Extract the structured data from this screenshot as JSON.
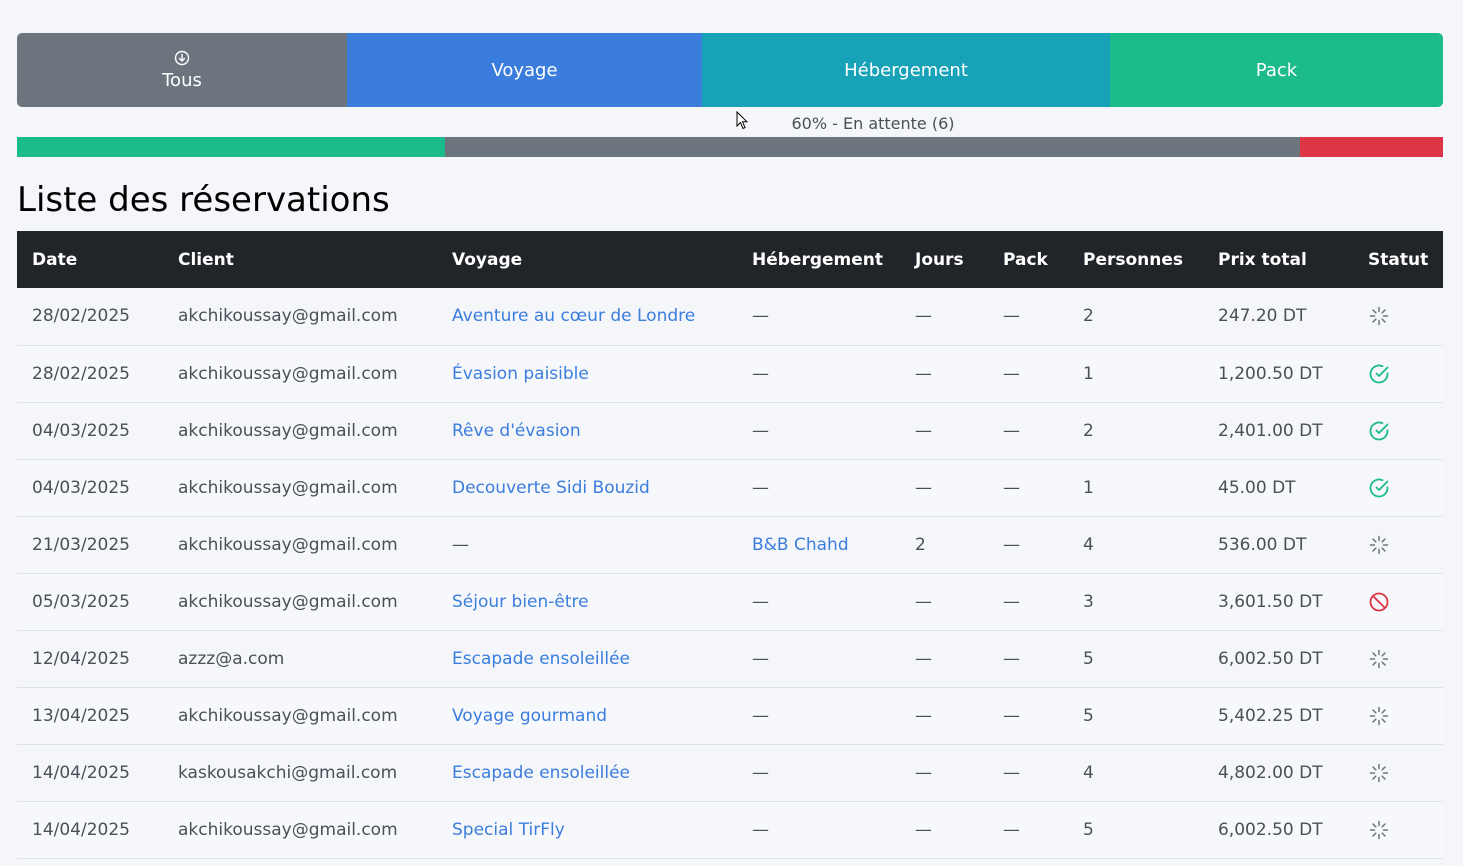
{
  "filters": {
    "tous": "Tous",
    "voyage": "Voyage",
    "hebergement": "Hébergement",
    "pack": "Pack"
  },
  "progress": {
    "label": "60% - En attente (6)",
    "confirmed_fraction": 0.3,
    "pending_fraction": 0.6,
    "cancelled_fraction": 0.1
  },
  "page_title": "Liste des réservations",
  "table": {
    "headers": [
      "Date",
      "Client",
      "Voyage",
      "Hébergement",
      "Jours",
      "Pack",
      "Personnes",
      "Prix total",
      "Statut"
    ],
    "rows": [
      {
        "date": "28/02/2025",
        "client": "akchikoussay@gmail.com",
        "voyage": "Aventure au cœur de Londre",
        "voyage_link": true,
        "hebergement": "—",
        "heb_link": false,
        "jours": "—",
        "pack": "—",
        "personnes": "2",
        "prix": "247.20 DT",
        "statut": "pending"
      },
      {
        "date": "28/02/2025",
        "client": "akchikoussay@gmail.com",
        "voyage": "Évasion paisible",
        "voyage_link": true,
        "hebergement": "—",
        "heb_link": false,
        "jours": "—",
        "pack": "—",
        "personnes": "1",
        "prix": "1,200.50 DT",
        "statut": "confirmed"
      },
      {
        "date": "04/03/2025",
        "client": "akchikoussay@gmail.com",
        "voyage": "Rêve d'évasion",
        "voyage_link": true,
        "hebergement": "—",
        "heb_link": false,
        "jours": "—",
        "pack": "—",
        "personnes": "2",
        "prix": "2,401.00 DT",
        "statut": "confirmed"
      },
      {
        "date": "04/03/2025",
        "client": "akchikoussay@gmail.com",
        "voyage": "Decouverte Sidi Bouzid",
        "voyage_link": true,
        "hebergement": "—",
        "heb_link": false,
        "jours": "—",
        "pack": "—",
        "personnes": "1",
        "prix": "45.00 DT",
        "statut": "confirmed"
      },
      {
        "date": "21/03/2025",
        "client": "akchikoussay@gmail.com",
        "voyage": "—",
        "voyage_link": false,
        "hebergement": "B&B Chahd",
        "heb_link": true,
        "jours": "2",
        "pack": "—",
        "personnes": "4",
        "prix": "536.00 DT",
        "statut": "pending"
      },
      {
        "date": "05/03/2025",
        "client": "akchikoussay@gmail.com",
        "voyage": "Séjour bien-être",
        "voyage_link": true,
        "hebergement": "—",
        "heb_link": false,
        "jours": "—",
        "pack": "—",
        "personnes": "3",
        "prix": "3,601.50 DT",
        "statut": "cancelled"
      },
      {
        "date": "12/04/2025",
        "client": "azzz@a.com",
        "voyage": "Escapade ensoleillée",
        "voyage_link": true,
        "hebergement": "—",
        "heb_link": false,
        "jours": "—",
        "pack": "—",
        "personnes": "5",
        "prix": "6,002.50 DT",
        "statut": "pending"
      },
      {
        "date": "13/04/2025",
        "client": "akchikoussay@gmail.com",
        "voyage": "Voyage gourmand",
        "voyage_link": true,
        "hebergement": "—",
        "heb_link": false,
        "jours": "—",
        "pack": "—",
        "personnes": "5",
        "prix": "5,402.25 DT",
        "statut": "pending"
      },
      {
        "date": "14/04/2025",
        "client": "kaskousakchi@gmail.com",
        "voyage": "Escapade ensoleillée",
        "voyage_link": true,
        "hebergement": "—",
        "heb_link": false,
        "jours": "—",
        "pack": "—",
        "personnes": "4",
        "prix": "4,802.00 DT",
        "statut": "pending"
      },
      {
        "date": "14/04/2025",
        "client": "akchikoussay@gmail.com",
        "voyage": "Special TirFly",
        "voyage_link": true,
        "hebergement": "—",
        "heb_link": false,
        "jours": "—",
        "pack": "—",
        "personnes": "5",
        "prix": "6,002.50 DT",
        "statut": "pending"
      }
    ]
  },
  "colors": {
    "confirmed": "#1cbb8c",
    "pending": "#6c757d",
    "cancelled": "#dc3545",
    "link": "#3b7ddd"
  },
  "icons": {
    "tous": "arrow-down-circle-icon",
    "pending": "loader-icon",
    "confirmed": "check-circle-icon",
    "cancelled": "slash-circle-icon"
  }
}
